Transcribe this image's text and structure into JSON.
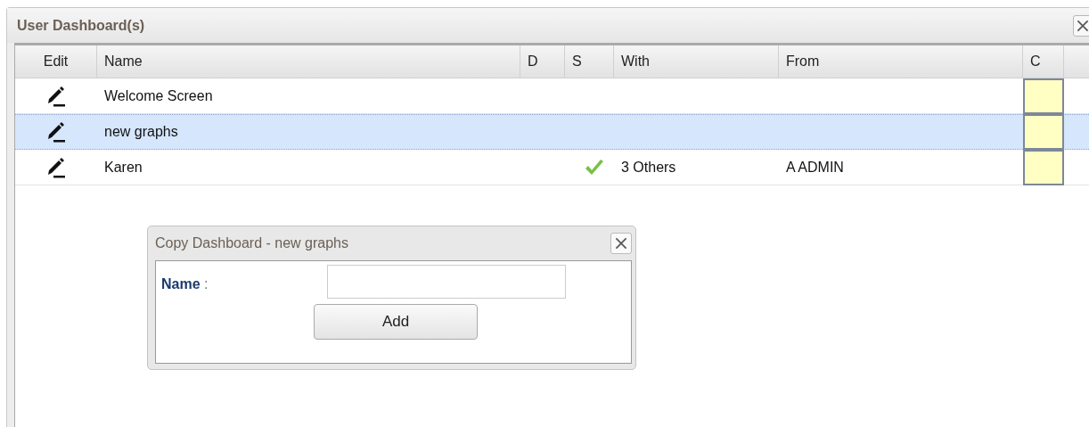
{
  "window": {
    "title": "User Dashboard(s)"
  },
  "table": {
    "columns": [
      "Edit",
      "Name",
      "D",
      "S",
      "With",
      "From",
      "C"
    ],
    "rows": [
      {
        "name": "Welcome Screen",
        "shared": false,
        "with": "",
        "from": "",
        "selected": false
      },
      {
        "name": "new graphs",
        "shared": false,
        "with": "",
        "from": "",
        "selected": true
      },
      {
        "name": "Karen",
        "shared": true,
        "with": "3 Others",
        "from": "A ADMIN",
        "selected": false
      }
    ]
  },
  "dialog": {
    "title": "Copy Dashboard - new graphs",
    "field_label": "**Name** :",
    "button": "Add"
  }
}
